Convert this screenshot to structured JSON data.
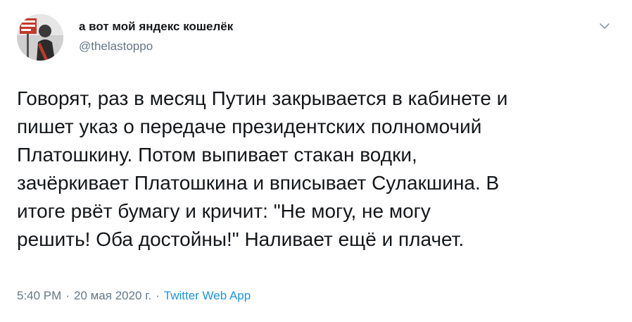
{
  "author": {
    "display_name": "а вот мой яндекс кошелёк",
    "handle": "@thelastoppo",
    "avatar_icon": "profile-photo"
  },
  "menu": {
    "caret_icon": "chevron-down-icon"
  },
  "tweet": {
    "lines": [
      "Говорят, раз в месяц Путин закрывается в кабинете и",
      "пишет указ о передаче президентских полномочий",
      "Платошкину. Потом выпивает стакан водки,",
      "зачёркивает Платошкина и вписывает Сулакшина. В",
      "итоге рвёт бумагу и кричит: \"Не могу, не могу",
      "решить! Оба достойны!\" Наливает ещё и плачет."
    ]
  },
  "meta": {
    "time": "5:40 PM",
    "separator": "·",
    "date": "20 мая 2020 г.",
    "source": "Twitter Web App"
  },
  "colors": {
    "text": "#14171a",
    "secondary": "#657786",
    "link": "#1b95e0"
  }
}
